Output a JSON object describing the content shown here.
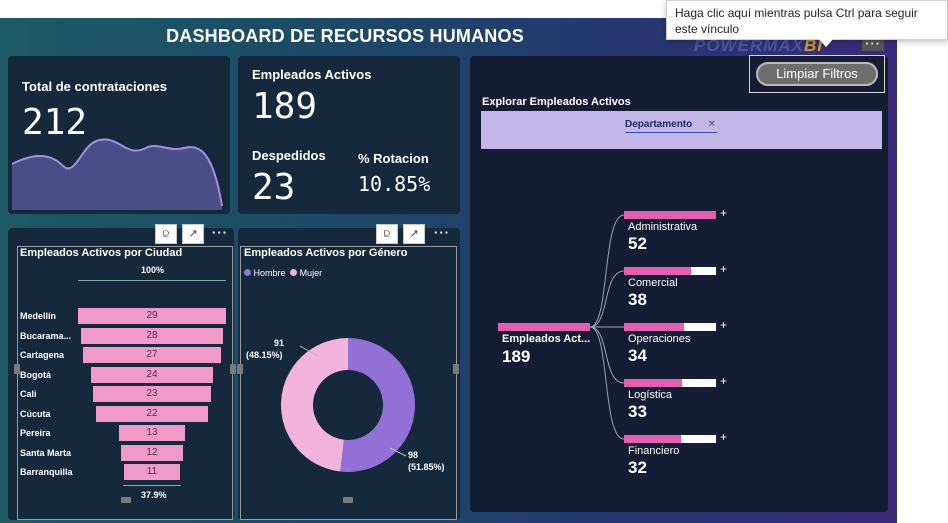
{
  "header": {
    "title": "DASHBOARD DE RECURSOS HUMANOS",
    "logo_main": "POWERMAX",
    "logo_accent": "BI"
  },
  "tooltip": {
    "text": "Haga clic aquí mientras pulsa Ctrl para seguir este vínculo"
  },
  "clear_button": {
    "label": "Limpiar Filtros"
  },
  "kpi_hires": {
    "label": "Total de contrataciones",
    "value": "212"
  },
  "kpi_active": {
    "label": "Empleados Activos",
    "value": "189",
    "fired_label": "Despedidos",
    "fired_value": "23",
    "rotation_label": "% Rotacion",
    "rotation_value": "10.85%"
  },
  "explore": {
    "label": "Explorar Empleados Activos",
    "field_chip": "Departamento",
    "chip_remove": "×"
  },
  "visual_menu": {
    "more": "···",
    "filter_icon": "funnel-icon",
    "focus_icon": "expand-icon"
  },
  "chart_data": [
    {
      "type": "bar",
      "title": "Empleados Activos por Ciudad",
      "top_label": "100%",
      "bottom_label": "37.9%",
      "categories": [
        "Medellín",
        "Bucarama...",
        "Cartagena",
        "Bogotá",
        "Cali",
        "Cúcuta",
        "Pereira",
        "Santa Marta",
        "Barranquilla"
      ],
      "values": [
        29,
        28,
        27,
        24,
        23,
        22,
        13,
        12,
        11
      ],
      "color": "#ef9ac9"
    },
    {
      "type": "pie",
      "title": "Empleados Activos por Género",
      "legend": [
        "Hombre",
        "Mujer"
      ],
      "labels": [
        "Hombre",
        "Mujer"
      ],
      "values": [
        98,
        91
      ],
      "value_labels": [
        "98",
        "91"
      ],
      "pct_labels": [
        "(51.85%)",
        "(48.15%)"
      ],
      "colors": [
        "#9370d6",
        "#f2b3dc"
      ]
    },
    {
      "type": "bar",
      "title": "Explorar Empleados Activos",
      "root": {
        "label": "Empleados Act...",
        "value": "189"
      },
      "categories": [
        "Administrativa",
        "Comercial",
        "Operaciones",
        "Logística",
        "Financiero"
      ],
      "values": [
        52,
        38,
        34,
        33,
        32
      ],
      "value_labels": [
        "52",
        "38",
        "34",
        "33",
        "32"
      ],
      "expand_symbol": "+",
      "color": "#e25fb0"
    }
  ]
}
